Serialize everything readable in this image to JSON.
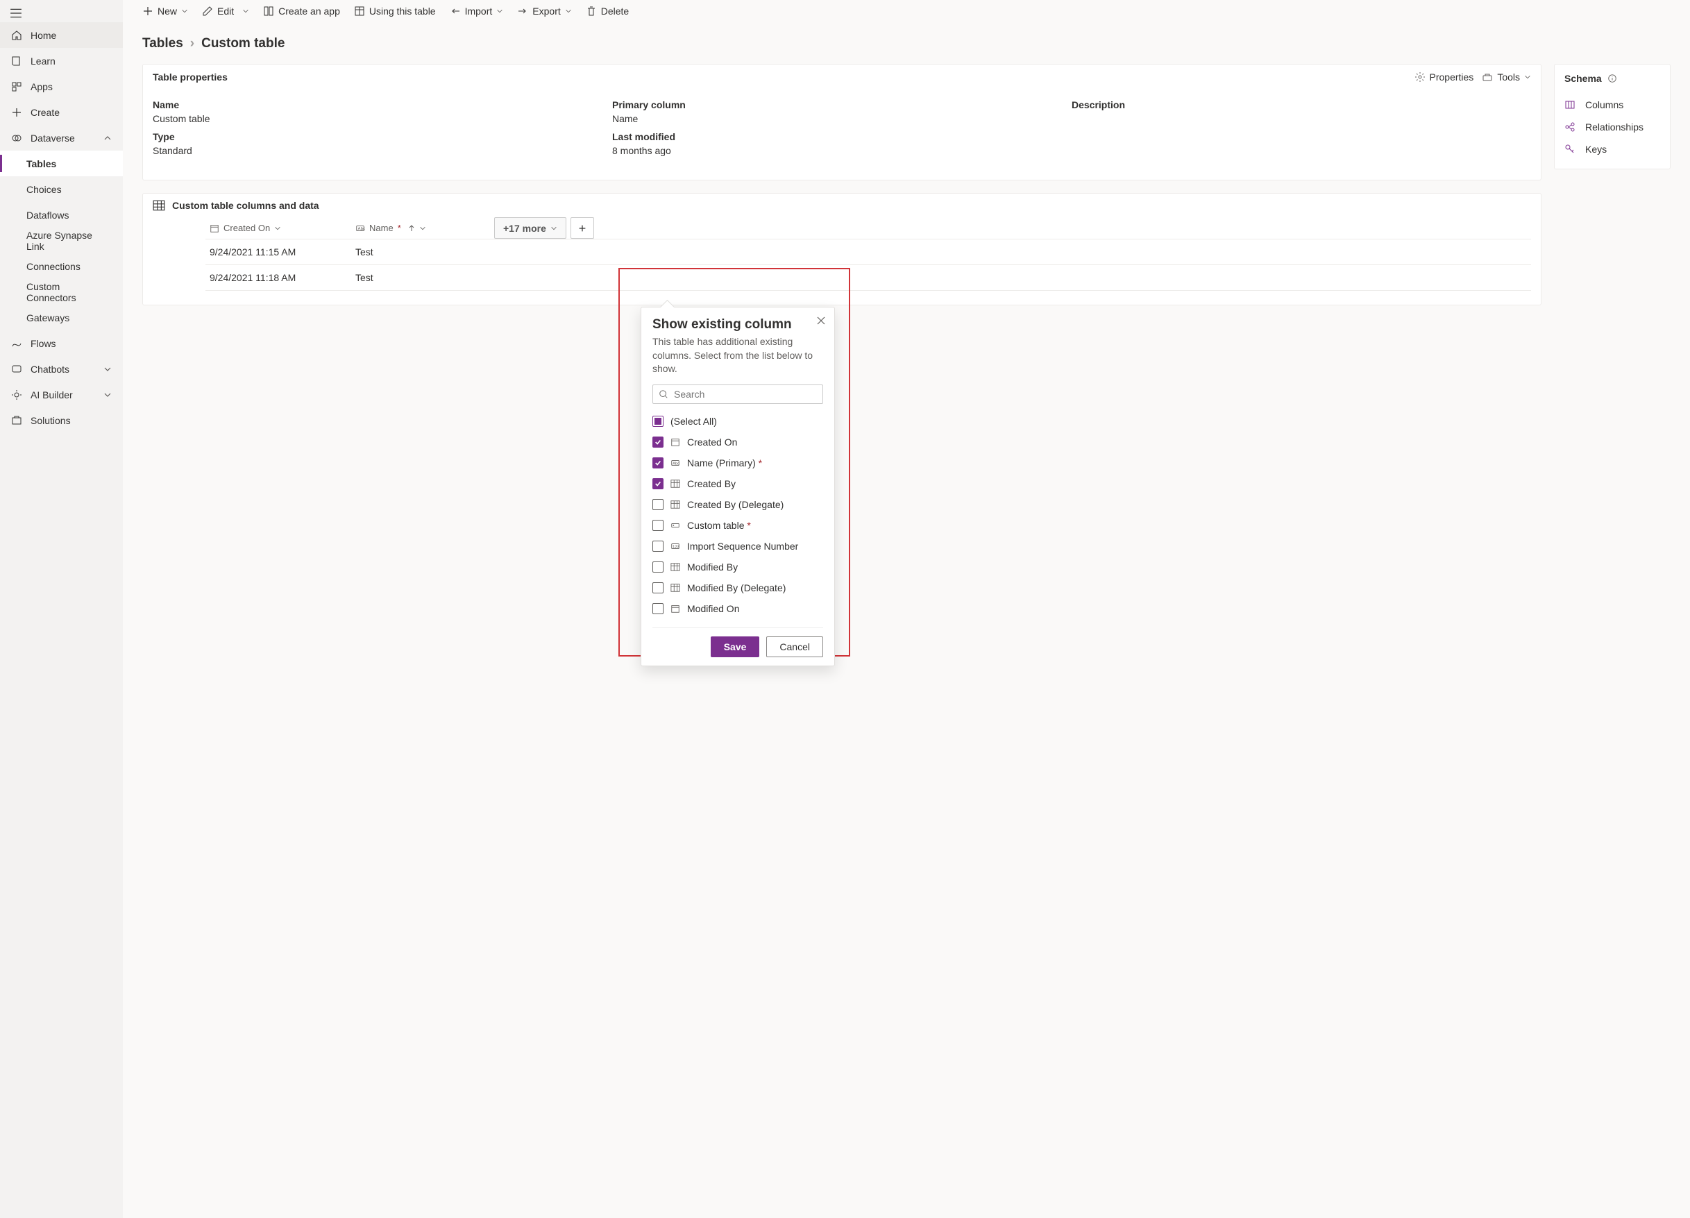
{
  "nav": {
    "home": "Home",
    "learn": "Learn",
    "apps": "Apps",
    "create": "Create",
    "dataverse": "Dataverse",
    "tables": "Tables",
    "choices": "Choices",
    "dataflows": "Dataflows",
    "synapse": "Azure Synapse Link",
    "connections": "Connections",
    "custom_connectors": "Custom Connectors",
    "gateways": "Gateways",
    "flows": "Flows",
    "chatbots": "Chatbots",
    "ai_builder": "AI Builder",
    "solutions": "Solutions"
  },
  "cmd": {
    "new": "New",
    "edit": "Edit",
    "create_app": "Create an app",
    "using_table": "Using this table",
    "import": "Import",
    "export": "Export",
    "delete": "Delete"
  },
  "breadcrumb": {
    "root": "Tables",
    "current": "Custom table"
  },
  "props": {
    "title": "Table properties",
    "properties_btn": "Properties",
    "tools_btn": "Tools",
    "name_label": "Name",
    "name_val": "Custom table",
    "type_label": "Type",
    "type_val": "Standard",
    "primary_label": "Primary column",
    "primary_val": "Name",
    "modified_label": "Last modified",
    "modified_val": "8 months ago",
    "desc_label": "Description"
  },
  "schema": {
    "title": "Schema",
    "columns": "Columns",
    "relationships": "Relationships",
    "keys": "Keys"
  },
  "data_card": {
    "title": "Custom table columns and data",
    "col_created": "Created On",
    "col_name": "Name",
    "more_btn": "+17 more",
    "rows": [
      {
        "created": "9/24/2021 11:15 AM",
        "name": "Test"
      },
      {
        "created": "9/24/2021 11:18 AM",
        "name": "Test"
      }
    ]
  },
  "popover": {
    "title": "Show existing column",
    "subtitle": "This table has additional existing columns. Select from the list below to show.",
    "search_placeholder": "Search",
    "items": [
      {
        "label": "(Select All)",
        "state": "indeterminate",
        "type": "none"
      },
      {
        "label": "Created On",
        "state": "checked",
        "type": "date"
      },
      {
        "label": "Name (Primary)",
        "state": "checked",
        "type": "text",
        "required": true
      },
      {
        "label": "Created By",
        "state": "checked",
        "type": "lookup"
      },
      {
        "label": "Created By (Delegate)",
        "state": "unchecked",
        "type": "lookup"
      },
      {
        "label": "Custom table",
        "state": "unchecked",
        "type": "key",
        "required": true
      },
      {
        "label": "Import Sequence Number",
        "state": "unchecked",
        "type": "number"
      },
      {
        "label": "Modified By",
        "state": "unchecked",
        "type": "lookup"
      },
      {
        "label": "Modified By (Delegate)",
        "state": "unchecked",
        "type": "lookup"
      },
      {
        "label": "Modified On",
        "state": "unchecked",
        "type": "date"
      }
    ],
    "save": "Save",
    "cancel": "Cancel"
  }
}
